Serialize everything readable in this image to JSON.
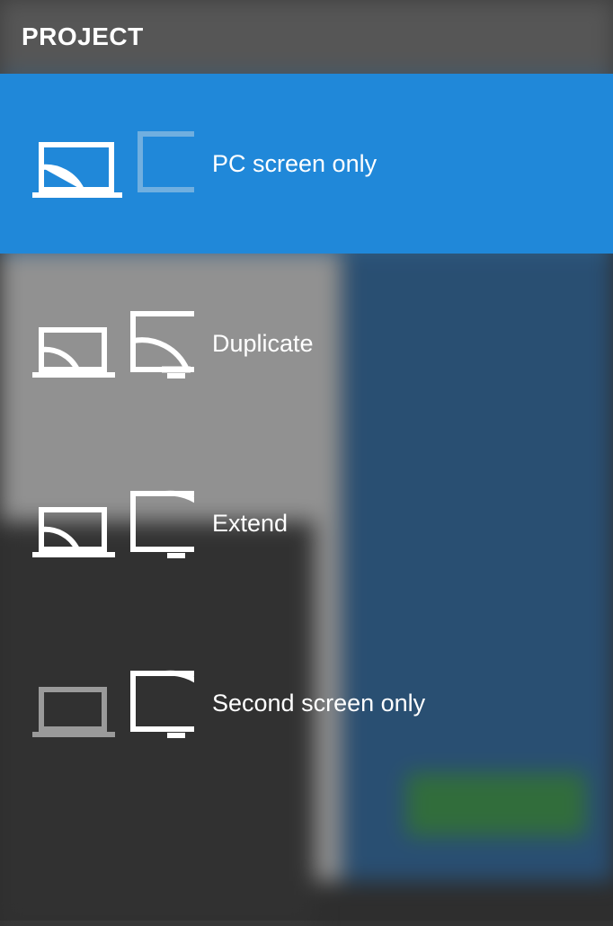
{
  "header": {
    "title": "PROJECT"
  },
  "options": [
    {
      "label": "PC screen only"
    },
    {
      "label": "Duplicate"
    },
    {
      "label": "Extend"
    },
    {
      "label": "Second screen only"
    }
  ]
}
